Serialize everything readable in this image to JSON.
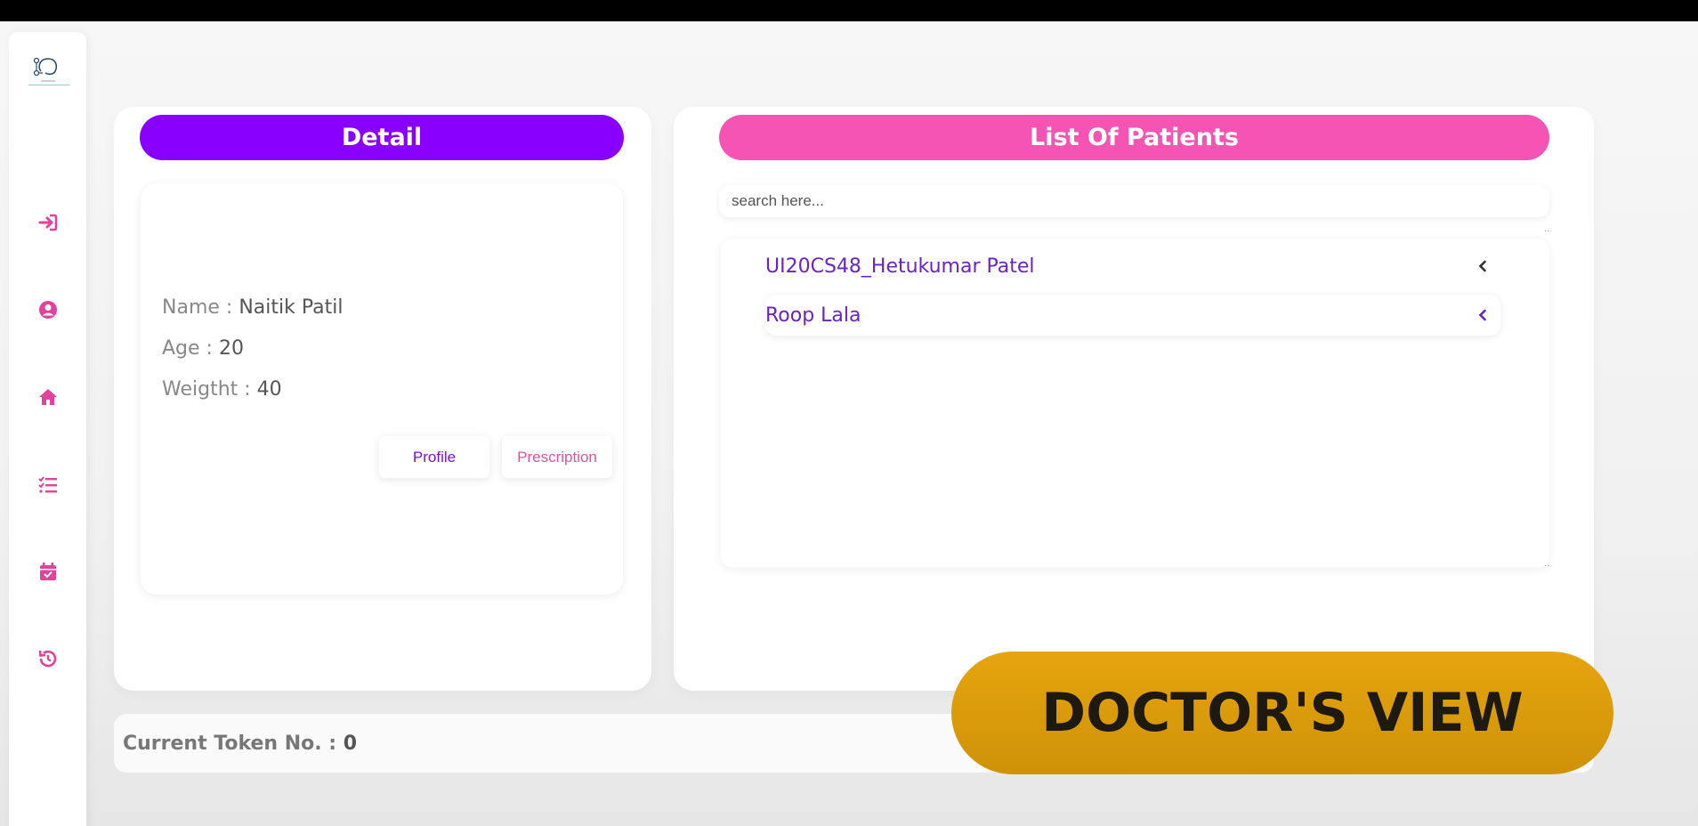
{
  "detail": {
    "title": "Detail",
    "name_label": "Name : ",
    "name_value": "Naitik Patil",
    "age_label": "Age : ",
    "age_value": "20",
    "weight_label": "Weigtht : ",
    "weight_value": "40",
    "profile_button": "Profile",
    "prescription_button": "Prescription"
  },
  "patients": {
    "title": "List Of Patients",
    "search_placeholder": "search here...",
    "items": [
      {
        "label": "UI20CS48_Hetukumar Patel"
      },
      {
        "label": "Roop Lala"
      }
    ]
  },
  "token": {
    "label": "Current Token No. : ",
    "value": "0"
  },
  "banner": {
    "text": "DOCTOR'S VIEW"
  },
  "sidebar": {
    "icons": [
      "login-icon",
      "user-circle-icon",
      "home-icon",
      "checklist-icon",
      "calendar-check-icon",
      "history-icon"
    ]
  },
  "colors": {
    "detail_header": "#8a00ff",
    "patients_header": "#f654b4",
    "sidebar_icon": "#e0429c",
    "banner": "#dba10d",
    "patient_name": "#6a23c5"
  }
}
